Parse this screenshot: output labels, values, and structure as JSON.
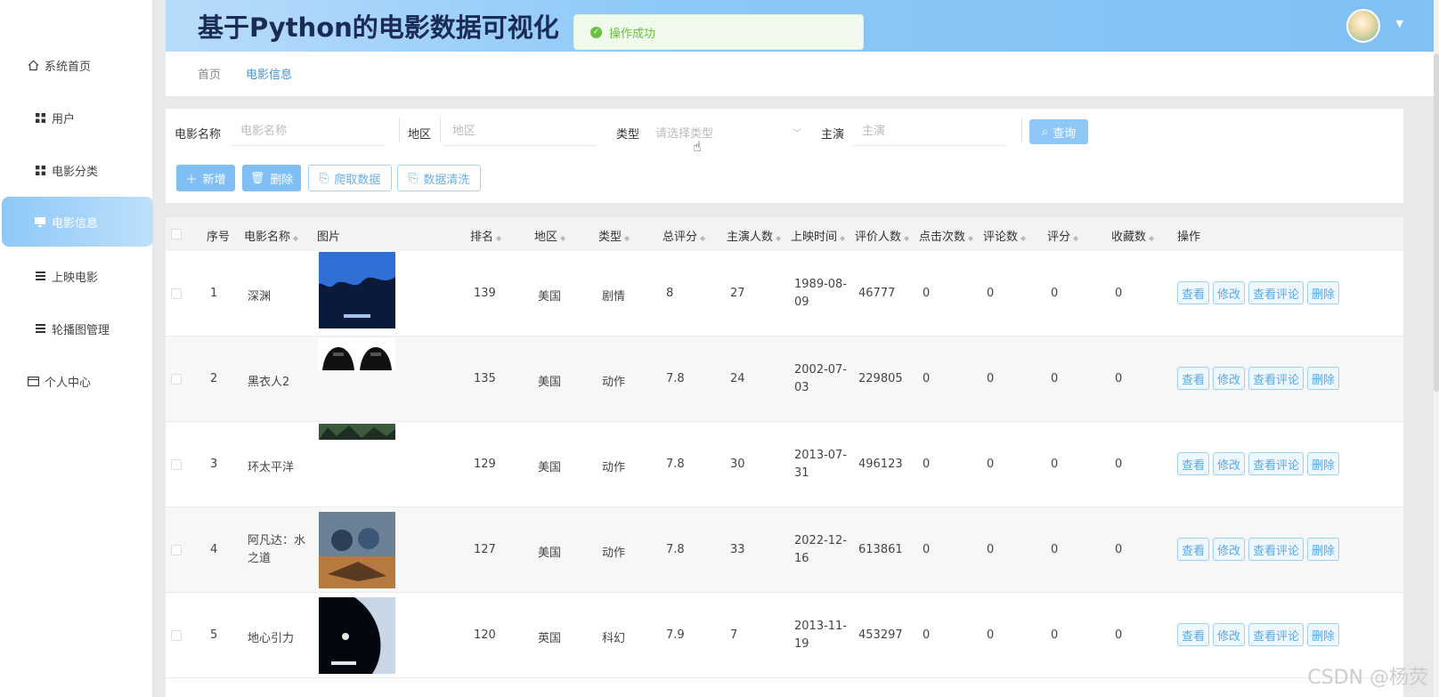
{
  "header": {
    "title": "基于Python的电影数据可视化"
  },
  "toast": {
    "message": "操作成功"
  },
  "sidebar": {
    "items": [
      {
        "label": "系统首页",
        "icon": "home-icon"
      },
      {
        "label": "用户",
        "icon": "grid-icon"
      },
      {
        "label": "电影分类",
        "icon": "grid-icon"
      },
      {
        "label": "电影信息",
        "icon": "monitor-icon",
        "active": true
      },
      {
        "label": "上映电影",
        "icon": "list-icon"
      },
      {
        "label": "轮播图管理",
        "icon": "list-icon"
      },
      {
        "label": "个人中心",
        "icon": "card-icon"
      }
    ]
  },
  "breadcrumb": {
    "home": "首页",
    "current": "电影信息"
  },
  "search": {
    "name_label": "电影名称",
    "name_placeholder": "电影名称",
    "region_label": "地区",
    "region_placeholder": "地区",
    "type_label": "类型",
    "type_placeholder": "请选择类型",
    "actor_label": "主演",
    "actor_placeholder": "主演",
    "query_label": "查询"
  },
  "toolbar": {
    "add": "新增",
    "delete": "删除",
    "crawl": "爬取数据",
    "clean": "数据清洗"
  },
  "table": {
    "headers": [
      "序号",
      "电影名称",
      "图片",
      "排名",
      "地区",
      "类型",
      "总评分",
      "主演人数",
      "上映时间",
      "评价人数",
      "点击次数",
      "评论数",
      "评分",
      "收藏数",
      "操作"
    ],
    "actions": [
      "查看",
      "修改",
      "查看评论",
      "删除"
    ],
    "rows": [
      {
        "idx": "1",
        "name": "深渊",
        "rank": "139",
        "region": "美国",
        "type": "剧情",
        "score": "8",
        "actors": "27",
        "date": "1989-08-09",
        "reviews": "46777",
        "clicks": "0",
        "comments": "0",
        "rating": "0",
        "favs": "0"
      },
      {
        "idx": "2",
        "name": "黑衣人2",
        "rank": "135",
        "region": "美国",
        "type": "动作",
        "score": "7.8",
        "actors": "24",
        "date": "2002-07-03",
        "reviews": "229805",
        "clicks": "0",
        "comments": "0",
        "rating": "0",
        "favs": "0"
      },
      {
        "idx": "3",
        "name": "环太平洋",
        "rank": "129",
        "region": "美国",
        "type": "动作",
        "score": "7.8",
        "actors": "30",
        "date": "2013-07-31",
        "reviews": "496123",
        "clicks": "0",
        "comments": "0",
        "rating": "0",
        "favs": "0"
      },
      {
        "idx": "4",
        "name": "阿凡达：水之道",
        "rank": "127",
        "region": "美国",
        "type": "动作",
        "score": "7.8",
        "actors": "33",
        "date": "2022-12-16",
        "reviews": "613861",
        "clicks": "0",
        "comments": "0",
        "rating": "0",
        "favs": "0"
      },
      {
        "idx": "5",
        "name": "地心引力",
        "rank": "120",
        "region": "英国",
        "type": "科幻",
        "score": "7.9",
        "actors": "7",
        "date": "2013-11-19",
        "reviews": "453297",
        "clicks": "0",
        "comments": "0",
        "rating": "0",
        "favs": "0"
      }
    ]
  },
  "watermark": "CSDN @杨荧"
}
